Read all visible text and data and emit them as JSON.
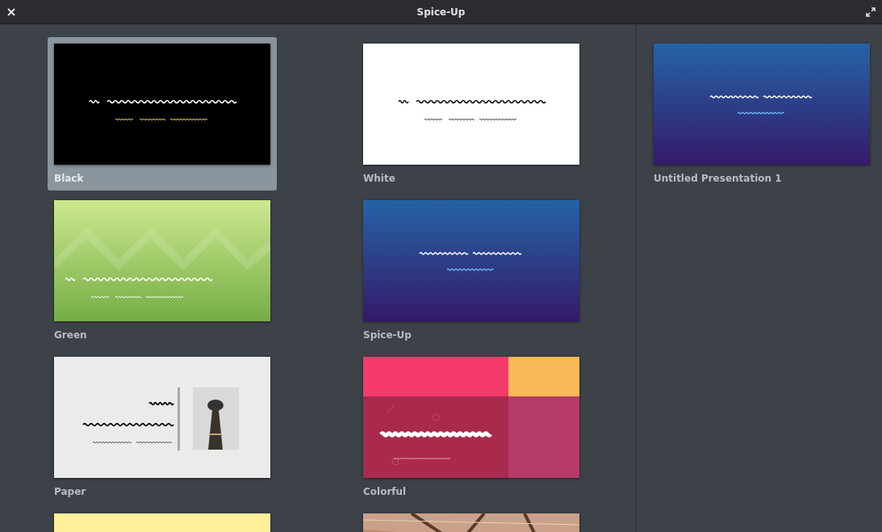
{
  "window": {
    "title": "Spice-Up"
  },
  "templates": [
    {
      "name": "Black",
      "kind": "black",
      "selected": true
    },
    {
      "name": "White",
      "kind": "white",
      "selected": false
    },
    {
      "name": "Green",
      "kind": "green",
      "selected": false
    },
    {
      "name": "Spice-Up",
      "kind": "blue",
      "selected": false
    },
    {
      "name": "Paper",
      "kind": "paper",
      "selected": false
    },
    {
      "name": "Colorful",
      "kind": "colorful",
      "selected": false
    },
    {
      "kind": "yellow",
      "selected": false
    },
    {
      "kind": "photo",
      "selected": false
    }
  ],
  "recent": [
    {
      "name": "Untitled Presentation 1",
      "kind": "blue",
      "selected": false
    }
  ]
}
